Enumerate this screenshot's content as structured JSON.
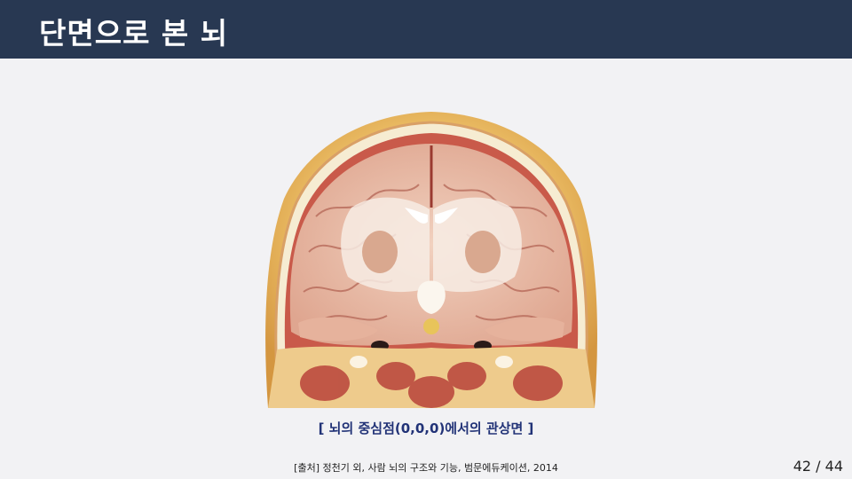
{
  "slide": {
    "title": "단면으로 본 뇌",
    "figure": {
      "icon": "brain-coronal-section-icon"
    },
    "caption": "[ 뇌의 중심점(0,0,0)에서의 관상면 ]",
    "source": "[출처] 정천기 외, 사람 뇌의 구조와 기능, 범문에듀케이션, 2014",
    "page": "42 / 44"
  },
  "colors": {
    "header_bg": "#283852",
    "slide_bg": "#f2f2f4",
    "caption_text": "#223377"
  }
}
